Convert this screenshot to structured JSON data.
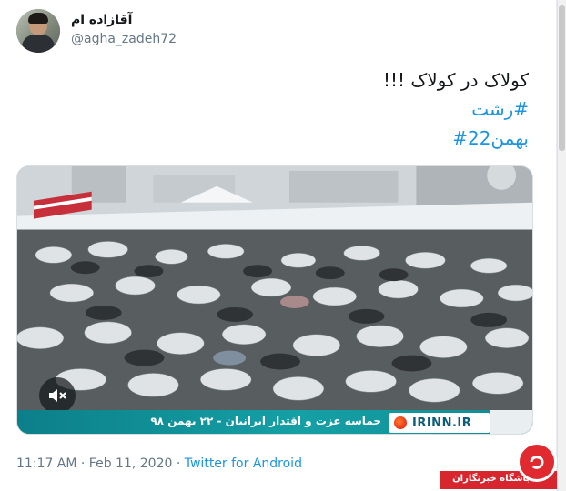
{
  "tweet": {
    "display_name": "آقازاده ام",
    "handle": "@agha_zadeh72",
    "text_line_1": "کولاک در کولاک !!!",
    "hashtag_1": "#رشت",
    "hashtag_2": "بهمن22#",
    "timestamp": "11:17 AM · Feb 11, 2020 ·",
    "source": "Twitter for Android"
  },
  "media": {
    "ticker_text": "حماسه عزت و اقتدار ایرانیان - ۲۲ بهمن ۹۸",
    "channel": "IRINN.IR",
    "mute_icon": "speaker-muted-icon"
  },
  "watermark": {
    "text": "باشگاه خبرنگاران"
  },
  "colors": {
    "link": "#1b95e0",
    "secondary_text": "#657786",
    "ticker": "#15a0a5",
    "watermark_red": "#d7262e"
  }
}
